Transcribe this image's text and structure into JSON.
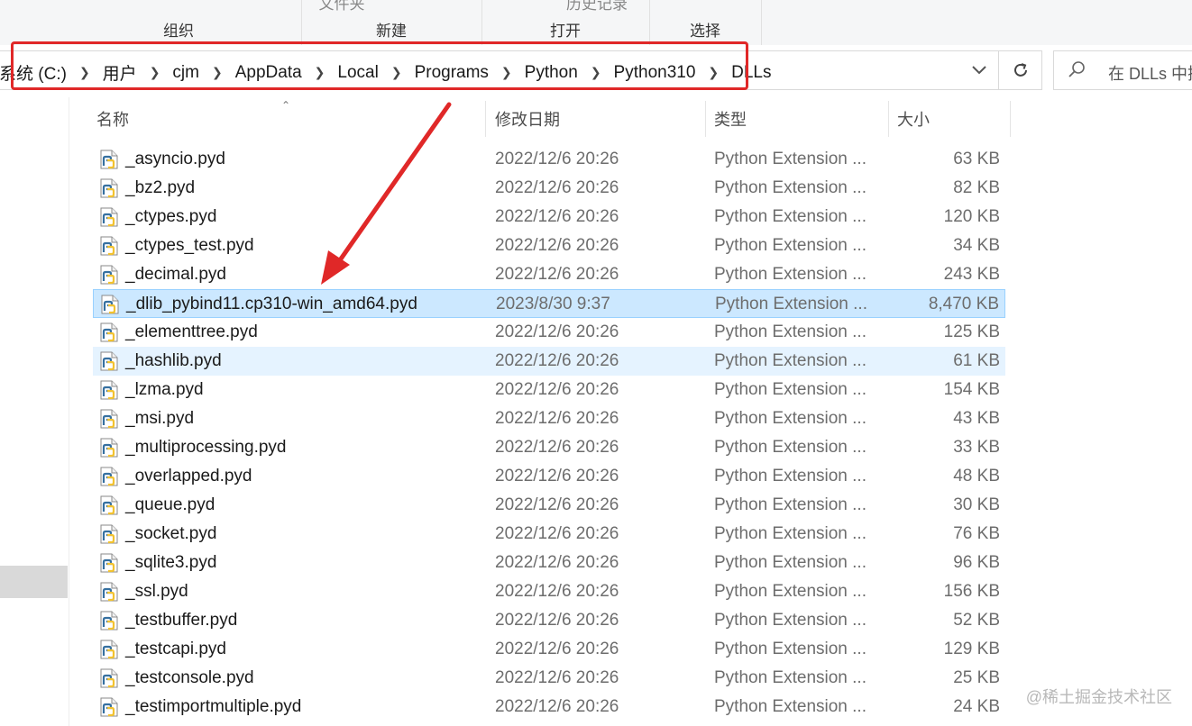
{
  "ribbon": {
    "groups": [
      {
        "label": "组织",
        "cut_text": ""
      },
      {
        "label": "新建",
        "cut_text": "文件夹"
      },
      {
        "label": "打开",
        "cut_text": "历史记录"
      },
      {
        "label": "选择",
        "cut_text": ""
      }
    ]
  },
  "address": {
    "crumbs": [
      "系统 (C:)",
      "用户",
      "cjm",
      "AppData",
      "Local",
      "Programs",
      "Python",
      "Python310",
      "DLLs"
    ]
  },
  "search": {
    "placeholder": "在 DLLs 中搜"
  },
  "columns": {
    "name": "名称",
    "date": "修改日期",
    "type": "类型",
    "size": "大小"
  },
  "files": [
    {
      "name": "_asyncio.pyd",
      "date": "2022/12/6 20:26",
      "type": "Python Extension ...",
      "size": "63 KB"
    },
    {
      "name": "_bz2.pyd",
      "date": "2022/12/6 20:26",
      "type": "Python Extension ...",
      "size": "82 KB"
    },
    {
      "name": "_ctypes.pyd",
      "date": "2022/12/6 20:26",
      "type": "Python Extension ...",
      "size": "120 KB"
    },
    {
      "name": "_ctypes_test.pyd",
      "date": "2022/12/6 20:26",
      "type": "Python Extension ...",
      "size": "34 KB"
    },
    {
      "name": "_decimal.pyd",
      "date": "2022/12/6 20:26",
      "type": "Python Extension ...",
      "size": "243 KB"
    },
    {
      "name": "_dlib_pybind11.cp310-win_amd64.pyd",
      "date": "2023/8/30 9:37",
      "type": "Python Extension ...",
      "size": "8,470 KB",
      "state": "selected"
    },
    {
      "name": "_elementtree.pyd",
      "date": "2022/12/6 20:26",
      "type": "Python Extension ...",
      "size": "125 KB"
    },
    {
      "name": "_hashlib.pyd",
      "date": "2022/12/6 20:26",
      "type": "Python Extension ...",
      "size": "61 KB",
      "state": "hover"
    },
    {
      "name": "_lzma.pyd",
      "date": "2022/12/6 20:26",
      "type": "Python Extension ...",
      "size": "154 KB"
    },
    {
      "name": "_msi.pyd",
      "date": "2022/12/6 20:26",
      "type": "Python Extension ...",
      "size": "43 KB"
    },
    {
      "name": "_multiprocessing.pyd",
      "date": "2022/12/6 20:26",
      "type": "Python Extension ...",
      "size": "33 KB"
    },
    {
      "name": "_overlapped.pyd",
      "date": "2022/12/6 20:26",
      "type": "Python Extension ...",
      "size": "48 KB"
    },
    {
      "name": "_queue.pyd",
      "date": "2022/12/6 20:26",
      "type": "Python Extension ...",
      "size": "30 KB"
    },
    {
      "name": "_socket.pyd",
      "date": "2022/12/6 20:26",
      "type": "Python Extension ...",
      "size": "76 KB"
    },
    {
      "name": "_sqlite3.pyd",
      "date": "2022/12/6 20:26",
      "type": "Python Extension ...",
      "size": "96 KB"
    },
    {
      "name": "_ssl.pyd",
      "date": "2022/12/6 20:26",
      "type": "Python Extension ...",
      "size": "156 KB"
    },
    {
      "name": "_testbuffer.pyd",
      "date": "2022/12/6 20:26",
      "type": "Python Extension ...",
      "size": "52 KB"
    },
    {
      "name": "_testcapi.pyd",
      "date": "2022/12/6 20:26",
      "type": "Python Extension ...",
      "size": "129 KB"
    },
    {
      "name": "_testconsole.pyd",
      "date": "2022/12/6 20:26",
      "type": "Python Extension ...",
      "size": "25 KB"
    },
    {
      "name": "_testimportmultiple.pyd",
      "date": "2022/12/6 20:26",
      "type": "Python Extension ...",
      "size": "24 KB"
    }
  ],
  "watermark": "@稀土掘金技术社区",
  "colors": {
    "annotation_red": "#e02828",
    "selected_bg": "#cce8ff",
    "hover_bg": "#e5f3ff"
  },
  "icons": {
    "file": "python-file-icon",
    "search": "search-icon",
    "refresh": "refresh-icon",
    "dropdown": "chevron-down-icon"
  }
}
